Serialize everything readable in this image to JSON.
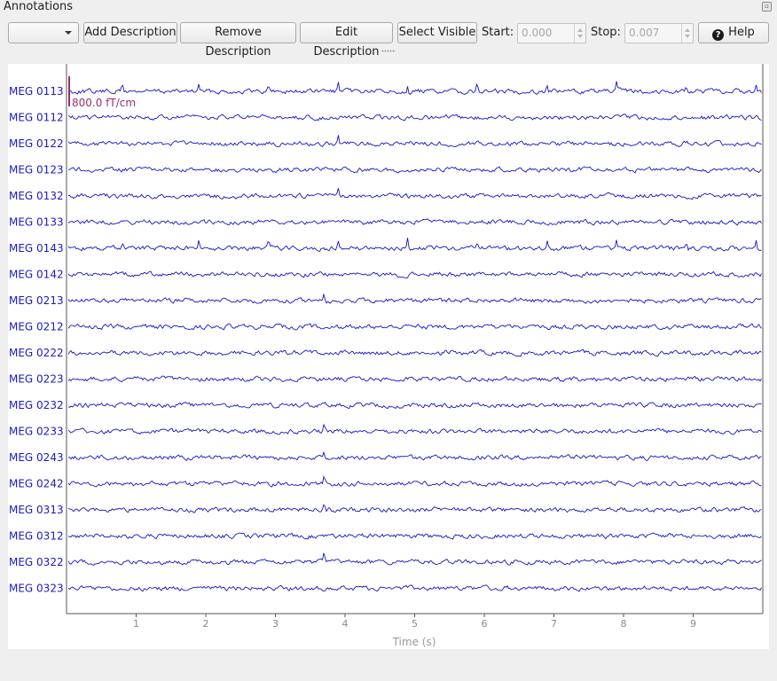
{
  "dock": {
    "title": "Annotations"
  },
  "toolbar": {
    "description_select": "",
    "add_label": "Add Description",
    "remove_label": "Remove Description",
    "edit_label": "Edit Description",
    "select_visible_label": "Select Visible",
    "start_label": "Start:",
    "start_value": "0.000",
    "stop_label": "Stop:",
    "stop_value": "0.007",
    "help_label": "Help"
  },
  "plot": {
    "scale_bar_label": "800.0 fT/cm",
    "xlabel": "Time (s)",
    "xticks": [
      "1",
      "2",
      "3",
      "4",
      "5",
      "6",
      "7",
      "8",
      "9"
    ]
  },
  "chart_data": {
    "type": "line",
    "xlabel": "Time (s)",
    "xlim": [
      0,
      10
    ],
    "xticks": [
      1,
      2,
      3,
      4,
      5,
      6,
      7,
      8,
      9
    ],
    "series_color": "#1515c8",
    "scale_bar": {
      "label": "800.0 fT/cm",
      "color": "#9b2f6e"
    },
    "channels": [
      {
        "name": "MEG 0113",
        "spikes": [
          0.8,
          1.9,
          2.9,
          3.9,
          4.9,
          5.9,
          6.9,
          7.9,
          8.9,
          9.9
        ]
      },
      {
        "name": "MEG 0112",
        "spikes": []
      },
      {
        "name": "MEG 0122",
        "spikes": [
          3.9
        ]
      },
      {
        "name": "MEG 0123",
        "spikes": []
      },
      {
        "name": "MEG 0132",
        "spikes": [
          3.9
        ]
      },
      {
        "name": "MEG 0133",
        "spikes": []
      },
      {
        "name": "MEG 0143",
        "spikes": [
          0.8,
          1.9,
          2.9,
          3.9,
          4.9,
          5.9,
          6.9,
          7.9,
          8.9,
          9.9
        ]
      },
      {
        "name": "MEG 0142",
        "spikes": []
      },
      {
        "name": "MEG 0213",
        "spikes": [
          3.7
        ]
      },
      {
        "name": "MEG 0212",
        "spikes": []
      },
      {
        "name": "MEG 0222",
        "spikes": []
      },
      {
        "name": "MEG 0223",
        "spikes": []
      },
      {
        "name": "MEG 0232",
        "spikes": []
      },
      {
        "name": "MEG 0233",
        "spikes": [
          3.7
        ]
      },
      {
        "name": "MEG 0243",
        "spikes": [
          3.7
        ]
      },
      {
        "name": "MEG 0242",
        "spikes": [
          3.7
        ]
      },
      {
        "name": "MEG 0313",
        "spikes": [
          3.7
        ]
      },
      {
        "name": "MEG 0312",
        "spikes": []
      },
      {
        "name": "MEG 0322",
        "spikes": [
          3.7
        ]
      },
      {
        "name": "MEG 0323",
        "spikes": []
      }
    ]
  }
}
